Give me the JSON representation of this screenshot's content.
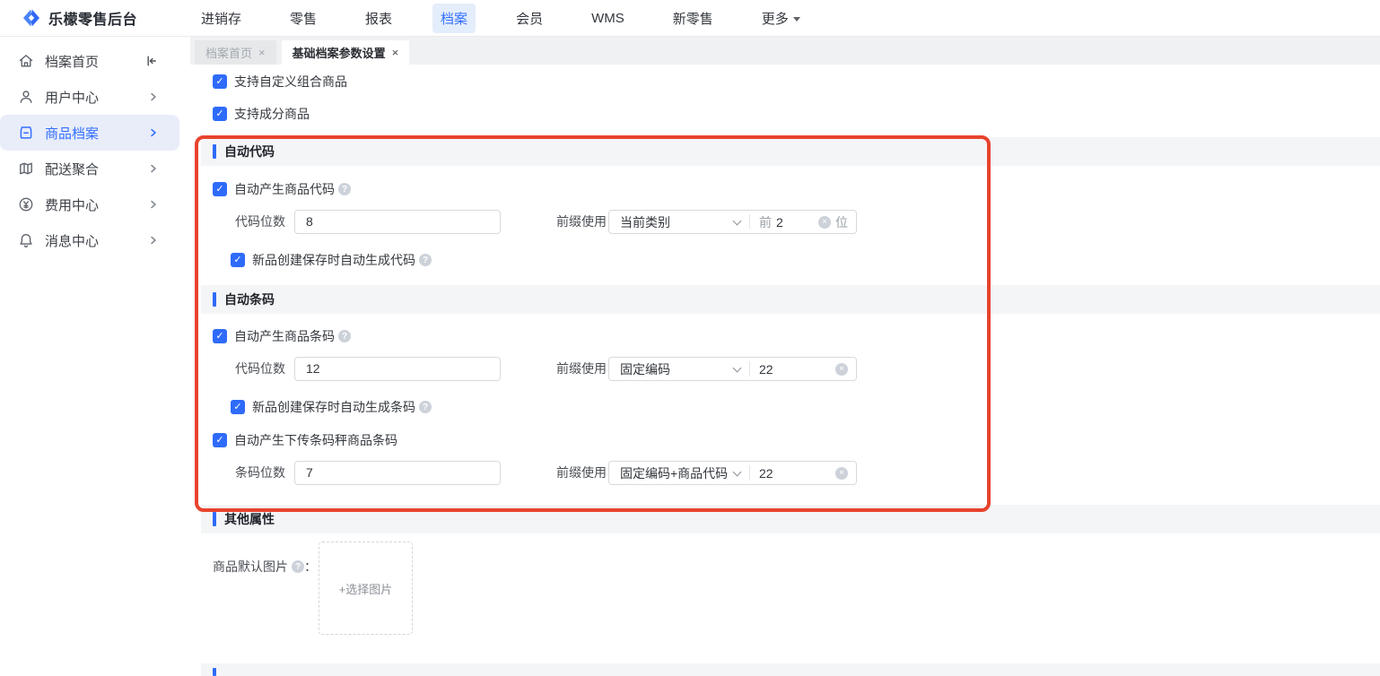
{
  "app": {
    "title": "乐檬零售后台"
  },
  "navbar": {
    "items": [
      {
        "label": "进销存"
      },
      {
        "label": "零售"
      },
      {
        "label": "报表"
      },
      {
        "label": "档案",
        "active": true
      },
      {
        "label": "会员"
      },
      {
        "label": "WMS"
      },
      {
        "label": "新零售"
      },
      {
        "label": "更多",
        "has_caret": true
      }
    ]
  },
  "sidebar": {
    "items": [
      {
        "label": "档案首页",
        "icon": "home-icon"
      },
      {
        "label": "用户中心",
        "icon": "user-icon"
      },
      {
        "label": "商品档案",
        "icon": "product-icon",
        "active": true
      },
      {
        "label": "配送聚合",
        "icon": "delivery-icon"
      },
      {
        "label": "费用中心",
        "icon": "fee-icon"
      },
      {
        "label": "消息中心",
        "icon": "bell-icon"
      }
    ]
  },
  "tabs": [
    {
      "label": "档案首页",
      "active": false
    },
    {
      "label": "基础档案参数设置",
      "active": true
    }
  ],
  "icons": {
    "check": "✓",
    "help": "?",
    "clear": "×",
    "close": "×"
  },
  "content": {
    "cb_custom_combo": "支持自定义组合商品",
    "cb_component": "支持成分商品",
    "auto_code": {
      "title": "自动代码",
      "cb_generate": "自动产生商品代码",
      "digits_label": "代码位数",
      "digits_value": "8",
      "prefix_label": "前缀使用",
      "select_value": "当前类别",
      "input_prefix": "前",
      "input_value": "2",
      "input_suffix": "位",
      "cb_autogen": "新品创建保存时自动生成代码"
    },
    "auto_barcode": {
      "title": "自动条码",
      "cb_generate": "自动产生商品条码",
      "digits_label": "代码位数",
      "digits_value": "12",
      "prefix_label": "前缀使用",
      "select_value": "固定编码",
      "input_value": "22",
      "cb_autogen": "新品创建保存时自动生成条码",
      "cb_scale": "自动产生下传条码秤商品条码",
      "scale_digits_label": "条码位数",
      "scale_digits_value": "7",
      "scale_prefix_label": "前缀使用",
      "scale_select_value": "固定编码+商品代码",
      "scale_input_value": "22"
    },
    "other": {
      "title": "其他属性",
      "image_label": "商品默认图片",
      "colon": "：",
      "upload_text": "+选择图片"
    }
  },
  "colors": {
    "accent": "#3370ff",
    "annotation": "#e8432d",
    "section_band": "#f4f5f7"
  }
}
